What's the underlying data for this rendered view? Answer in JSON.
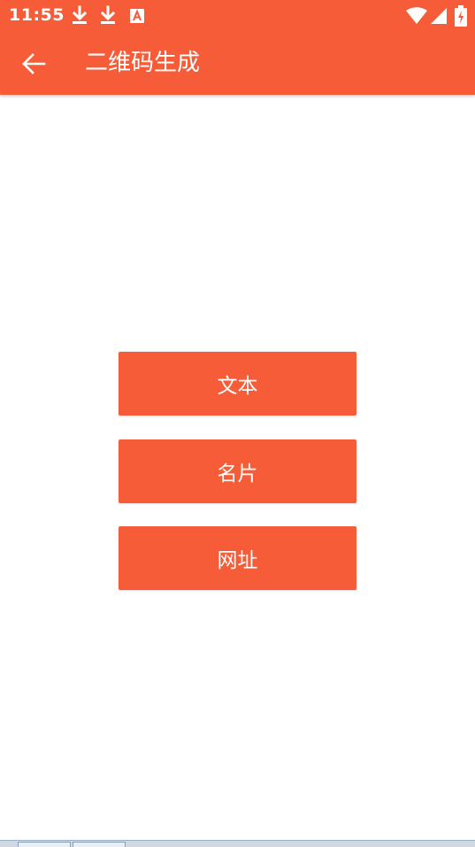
{
  "status_bar": {
    "time": "11:55",
    "left_icons": [
      "download-icon",
      "download-icon",
      "a-badge-icon"
    ],
    "right_icons": [
      "wifi-icon",
      "signal-icon",
      "battery-charging-icon"
    ],
    "background": "#f55c37"
  },
  "app_bar": {
    "title": "二维码生成",
    "back_icon": "arrow-left-icon",
    "background": "#f55c37"
  },
  "menu": {
    "buttons": [
      {
        "label": "文本"
      },
      {
        "label": "名片"
      },
      {
        "label": "网址"
      }
    ],
    "button_color": "#f55c37",
    "text_color": "#ffffff"
  }
}
